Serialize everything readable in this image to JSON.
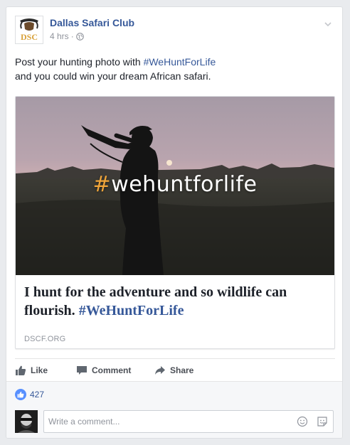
{
  "post": {
    "page_name": "Dallas Safari Club",
    "avatar_text": "DSC",
    "time": "4 hrs",
    "separator": "·",
    "text_before": "Post your hunting photo with ",
    "hashtag": "#WeHuntForLife",
    "text_after": "and you could win your dream African safari."
  },
  "preview": {
    "overlay_hash": "#",
    "overlay_word": "wehuntforlife",
    "headline": "I hunt for the adventure and so wildlife can flourish. ",
    "headline_hashtag": "#WeHuntForLife",
    "domain": "DSCF.ORG"
  },
  "actions": {
    "like": "Like",
    "comment": "Comment",
    "share": "Share"
  },
  "reactions": {
    "count": "427"
  },
  "comment": {
    "placeholder": "Write a comment..."
  },
  "colors": {
    "link": "#365899",
    "like_badge": "#5890ff",
    "overlay_hash": "#f0a53a"
  },
  "icons": [
    "globe-icon",
    "chevron-down-icon",
    "like-icon",
    "comment-icon",
    "share-icon",
    "emoji-icon",
    "sticker-icon"
  ]
}
